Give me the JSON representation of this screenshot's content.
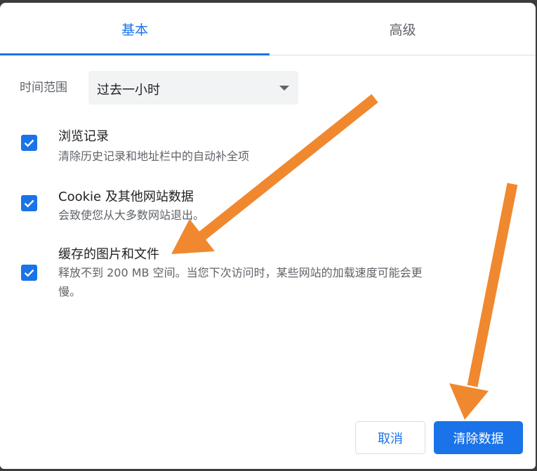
{
  "tabs": {
    "basic": "基本",
    "advanced": "高级"
  },
  "time_range": {
    "label": "时间范围",
    "selected": "过去一小时"
  },
  "items": [
    {
      "title": "浏览记录",
      "description": "清除历史记录和地址栏中的自动补全项",
      "checked": true
    },
    {
      "title": "Cookie 及其他网站数据",
      "description": "会致使您从大多数网站退出。",
      "checked": true
    },
    {
      "title": "缓存的图片和文件",
      "description_line1": "释放不到 200 MB 空间。当您下次访问时，某些网站的加载速度可能会更",
      "description_line2": "慢。",
      "checked": true
    }
  ],
  "buttons": {
    "cancel": "取消",
    "clear": "清除数据"
  },
  "colors": {
    "accent": "#1a73e8",
    "annotation_arrow": "#f0882f"
  },
  "icons": {
    "checkbox": "check-icon",
    "dropdown": "dropdown-arrow-icon",
    "annotation": "arrow-icon"
  }
}
